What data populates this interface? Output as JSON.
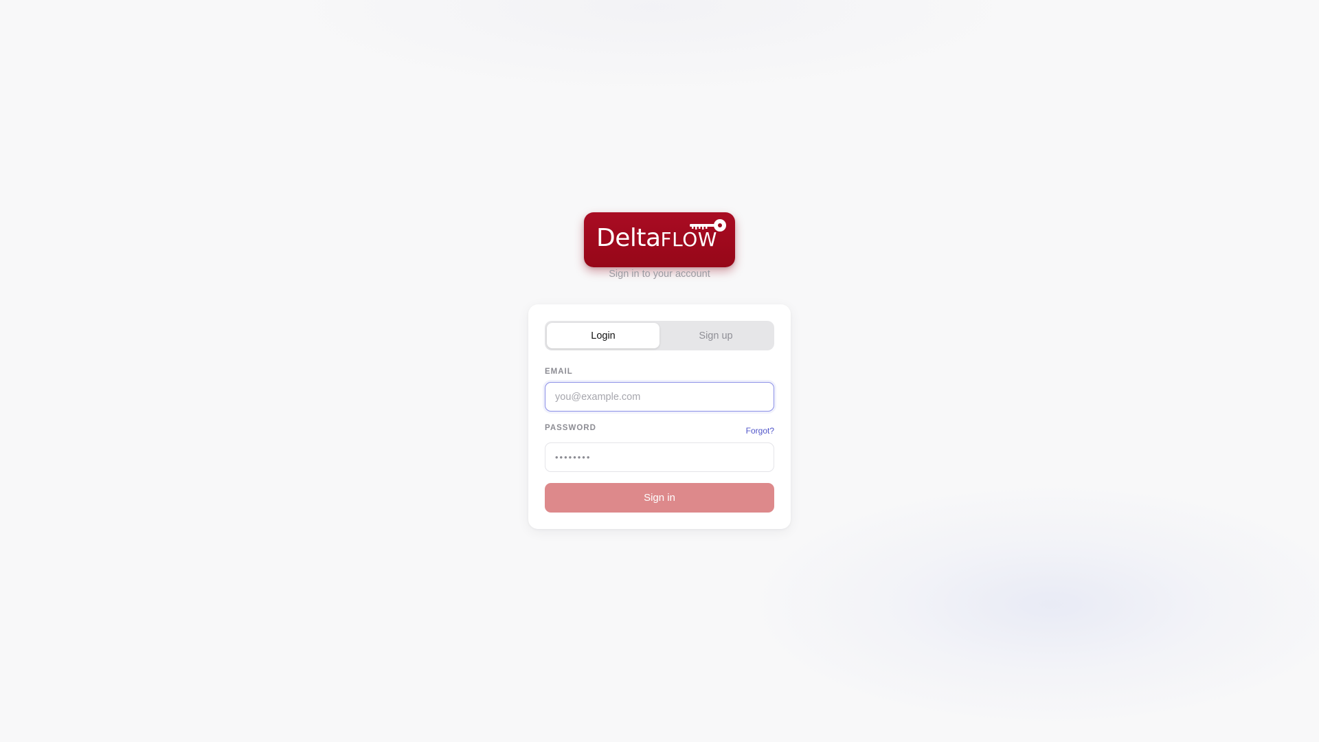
{
  "brand": {
    "logo_text_delta": "Delta",
    "logo_text_flow": "FLOW",
    "logo_color": "#a00b1e",
    "icon": "key-icon"
  },
  "subtitle": "Sign in to your account",
  "tabs": [
    {
      "label": "Login",
      "active": true
    },
    {
      "label": "Sign up",
      "active": false
    }
  ],
  "form": {
    "email_label": "EMAIL",
    "email_placeholder": "you@example.com",
    "email_value": "",
    "password_label": "PASSWORD",
    "password_value": "••••••••",
    "forgot_label": "Forgot?",
    "submit_label": "Sign in"
  },
  "colors": {
    "accent": "#4f54c9",
    "submit_button": "#dd898b",
    "focus_ring": "#8a8ee6"
  }
}
